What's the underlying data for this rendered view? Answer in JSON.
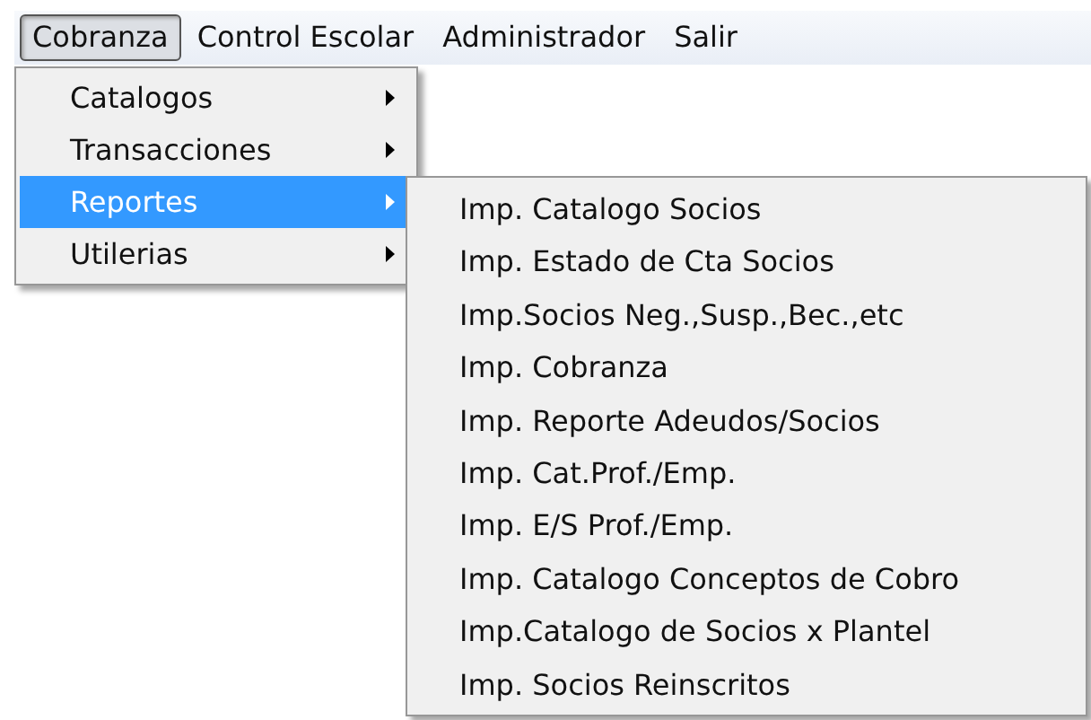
{
  "menubar": [
    {
      "label": "Cobranza",
      "selected": true
    },
    {
      "label": "Control Escolar",
      "selected": false
    },
    {
      "label": "Administrador",
      "selected": false
    },
    {
      "label": "Salir",
      "selected": false
    }
  ],
  "menu": {
    "items": [
      {
        "label": "Catalogos",
        "selected": false,
        "has_submenu": true
      },
      {
        "label": "Transacciones",
        "selected": false,
        "has_submenu": true
      },
      {
        "label": "Reportes",
        "selected": true,
        "has_submenu": true
      },
      {
        "label": "Utilerias",
        "selected": false,
        "has_submenu": true
      }
    ]
  },
  "submenu": {
    "items": [
      {
        "label": "Imp. Catalogo Socios"
      },
      {
        "label": "Imp. Estado de Cta Socios"
      },
      {
        "label": "Imp.Socios Neg.,Susp.,Bec.,etc"
      },
      {
        "label": "Imp. Cobranza"
      },
      {
        "label": "Imp. Reporte Adeudos/Socios"
      },
      {
        "label": "Imp. Cat.Prof./Emp."
      },
      {
        "label": "Imp. E/S Prof./Emp."
      },
      {
        "label": "Imp. Catalogo Conceptos de Cobro"
      },
      {
        "label": "Imp.Catalogo de Socios x Plantel"
      },
      {
        "label": "Imp. Socios Reinscritos"
      }
    ]
  }
}
